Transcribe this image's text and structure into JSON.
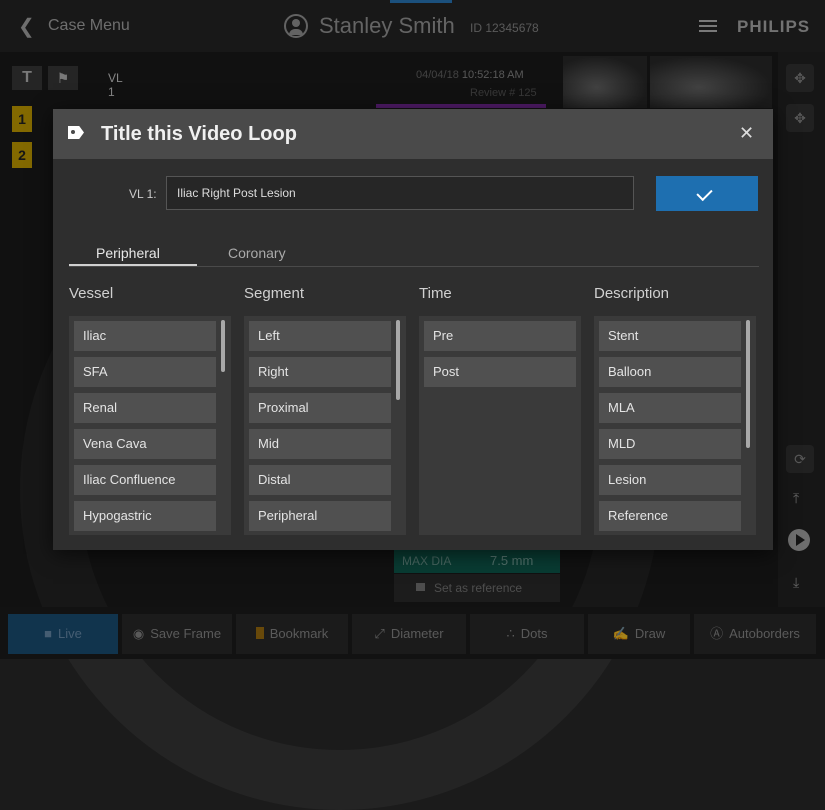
{
  "topbar": {
    "back_label": "Case Menu",
    "patient_name": "Stanley Smith",
    "patient_id": "ID 12345678",
    "brand": "PHILIPS"
  },
  "background": {
    "vl_label": "VL 1",
    "marker_1": "1",
    "marker_2": "2",
    "datetime": "04/04/18",
    "time": "10:52:18 AM",
    "review": "Review # 125",
    "max_dia_label": "MAX DIA",
    "max_dia_value": "7.5 mm",
    "set_reference": "Set as reference"
  },
  "bottom_toolbar": {
    "live": "Live",
    "save_frame": "Save Frame",
    "bookmark": "Bookmark",
    "diameter": "Diameter",
    "dots": "Dots",
    "draw": "Draw",
    "autoborders": "Autoborders"
  },
  "dialog": {
    "title": "Title this Video Loop",
    "field_label": "VL 1:",
    "field_value": "Iliac Right Post Lesion",
    "tabs": [
      "Peripheral",
      "Coronary"
    ],
    "active_tab": "Peripheral",
    "columns": {
      "vessel": {
        "title": "Vessel",
        "items": [
          "Iliac",
          "SFA",
          "Renal",
          "Vena Cava",
          "Iliac Confluence",
          "Hypogastric"
        ]
      },
      "segment": {
        "title": "Segment",
        "items": [
          "Left",
          "Right",
          "Proximal",
          "Mid",
          "Distal",
          "Peripheral"
        ]
      },
      "time": {
        "title": "Time",
        "items": [
          "Pre",
          "Post"
        ]
      },
      "description": {
        "title": "Description",
        "items": [
          "Stent",
          "Balloon",
          "MLA",
          "MLD",
          "Lesion",
          "Reference"
        ]
      }
    }
  },
  "colors": {
    "accent_blue": "#1e6fb0",
    "marker_yellow": "#c9a200",
    "dialog_header": "#4a4a4a",
    "list_item": "#505050"
  },
  "icons": [
    "back-chevron-icon",
    "user-icon",
    "menu-icon",
    "tag-icon",
    "close-icon",
    "check-icon",
    "camera-icon",
    "bookmark-icon",
    "diameter-icon",
    "dots-icon",
    "draw-icon",
    "autoborders-icon",
    "play-icon",
    "lock-icon"
  ]
}
